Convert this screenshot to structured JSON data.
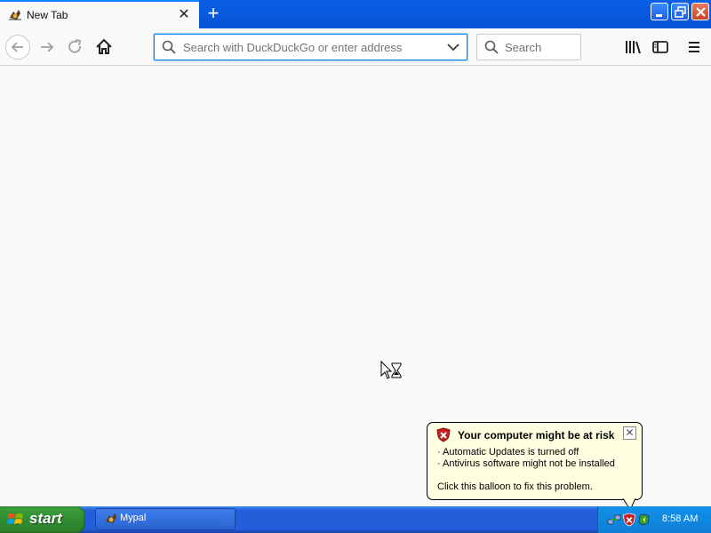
{
  "browser": {
    "tab": {
      "title": "New Tab"
    },
    "urlbar": {
      "placeholder": "Search with DuckDuckGo or enter address"
    },
    "searchbar": {
      "placeholder": "Search"
    }
  },
  "balloon": {
    "title": "Your computer might be at risk",
    "lines": [
      "Automatic Updates is turned off",
      "Antivirus software might not be installed"
    ],
    "footer": "Click this balloon to fix this problem."
  },
  "taskbar": {
    "start_label": "start",
    "task_label": "Mypal",
    "clock": "8:58 AM"
  },
  "colors": {
    "accent": "#0a84ff",
    "taskbar": "#245edb",
    "start_green": "#2f8a2f",
    "balloon_bg": "#ffffe1"
  },
  "icons": [
    "tab-favicon-icon",
    "close-icon",
    "plus-icon",
    "back-arrow-icon",
    "forward-arrow-icon",
    "reload-icon",
    "home-icon",
    "search-icon",
    "chevron-down-icon",
    "library-icon",
    "sidebar-icon",
    "hamburger-menu-icon",
    "shield-warning-icon",
    "windows-logo-icon",
    "network-icon",
    "update-icon",
    "hourglass-cursor-icon"
  ]
}
